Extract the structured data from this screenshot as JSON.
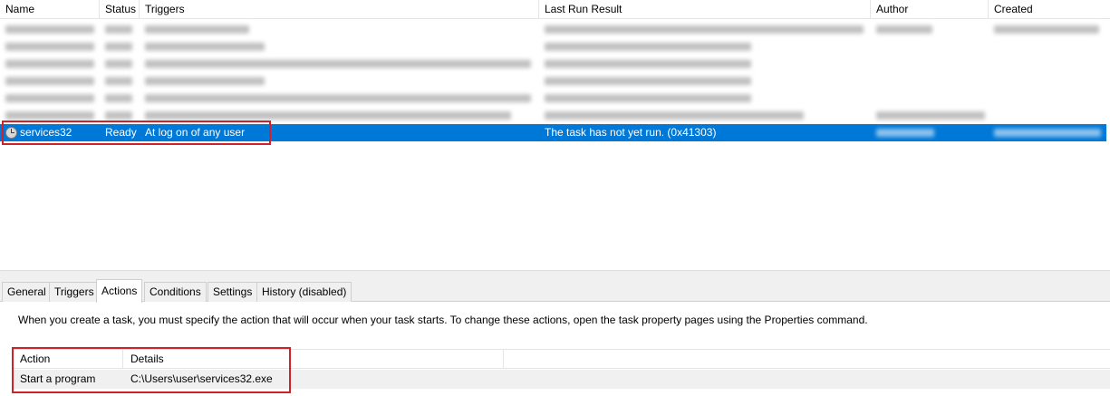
{
  "task_list": {
    "columns": [
      "Name",
      "Status",
      "Triggers",
      "Last Run Result",
      "Author",
      "Created"
    ],
    "selected_task": {
      "name": "services32",
      "status": "Ready",
      "trigger": "At log on of any user",
      "last_run_result": "The task has not yet run. (0x41303)"
    }
  },
  "tabs": [
    {
      "label": "General",
      "active": false
    },
    {
      "label": "Triggers",
      "active": false
    },
    {
      "label": "Actions",
      "active": true
    },
    {
      "label": "Conditions",
      "active": false
    },
    {
      "label": "Settings",
      "active": false
    },
    {
      "label": "History (disabled)",
      "active": false
    }
  ],
  "actions_panel": {
    "description": "When you create a task, you must specify the action that will occur when your task starts.  To change these actions, open the task property pages using the Properties command.",
    "columns": {
      "action": "Action",
      "details": "Details"
    },
    "rows": [
      {
        "action": "Start a program",
        "details": "C:\\Users\\user\\services32.exe"
      }
    ]
  },
  "colors": {
    "selection": "#0078d7",
    "highlight_box": "#d0222b"
  }
}
